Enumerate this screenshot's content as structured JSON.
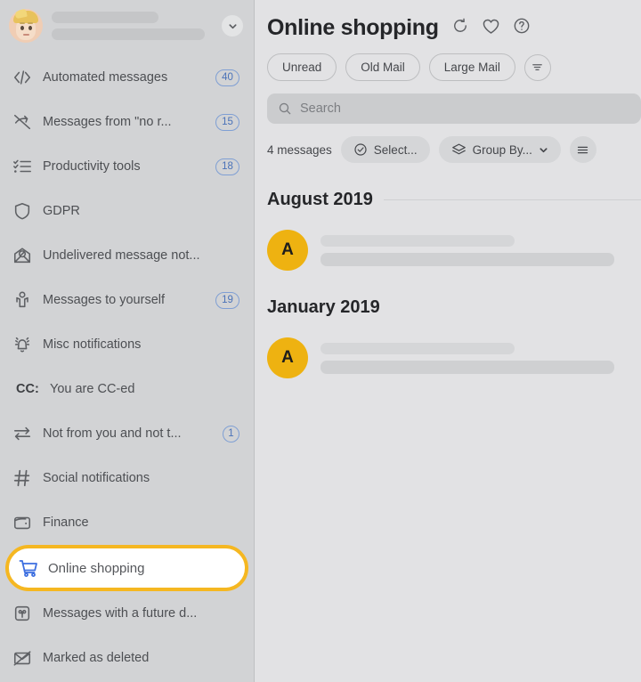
{
  "sidebar": {
    "account": {
      "avatar_name": "user-memoji-avatar",
      "expand_icon": "chevron-down-icon"
    },
    "items": [
      {
        "label": "Automated messages",
        "badge": "40",
        "icon": "code-brackets-icon",
        "selected": false
      },
      {
        "label": "Messages from \"no r...",
        "badge": "15",
        "icon": "no-reply-slash-icon",
        "selected": false
      },
      {
        "label": "Productivity tools",
        "badge": "18",
        "icon": "checklist-icon",
        "selected": false
      },
      {
        "label": "GDPR",
        "badge": "",
        "icon": "shield-icon",
        "selected": false
      },
      {
        "label": "Undelivered message not...",
        "badge": "",
        "icon": "undelivered-envelope-icon",
        "selected": false
      },
      {
        "label": "Messages to yourself",
        "badge": "19",
        "icon": "person-icon",
        "selected": false
      },
      {
        "label": "Misc notifications",
        "badge": "",
        "icon": "bell-ringing-icon",
        "selected": false
      },
      {
        "label": "You are CC-ed",
        "badge": "",
        "icon": "cc-text-icon",
        "prefix": "CC:",
        "selected": false
      },
      {
        "label": "Not from you and not t...",
        "badge": "1",
        "icon": "two-way-arrows-icon",
        "selected": false
      },
      {
        "label": "Social notifications",
        "badge": "",
        "icon": "hash-icon",
        "selected": false
      },
      {
        "label": "Finance",
        "badge": "",
        "icon": "wallet-icon",
        "selected": false
      },
      {
        "label": "Online shopping",
        "badge": "",
        "icon": "shopping-cart-icon",
        "selected": true
      },
      {
        "label": "Messages with a future d...",
        "badge": "",
        "icon": "future-date-icon",
        "selected": false
      },
      {
        "label": "Marked as deleted",
        "badge": "",
        "icon": "deleted-envelope-icon",
        "selected": false
      }
    ]
  },
  "main": {
    "title": "Online shopping",
    "header_icons": [
      {
        "name": "refresh-icon"
      },
      {
        "name": "heart-icon"
      },
      {
        "name": "help-icon"
      }
    ],
    "filter_pills": [
      {
        "label": "Unread"
      },
      {
        "label": "Old Mail"
      },
      {
        "label": "Large Mail"
      }
    ],
    "filter_icon_button": "filter-sort-icon",
    "search": {
      "placeholder": "Search",
      "icon": "search-icon"
    },
    "toolbar": {
      "count_label": "4 messages",
      "select_label": "Select...",
      "select_icon": "check-circle-icon",
      "group_by_label": "Group By...",
      "group_by_icon": "layers-icon",
      "group_by_chevron": "chevron-down-icon",
      "more_icon": "more-options-icon"
    },
    "groups": [
      {
        "title": "August 2019",
        "messages": [
          {
            "avatar_initial": "A"
          }
        ]
      },
      {
        "title": "January 2019",
        "messages": [
          {
            "avatar_initial": "A"
          }
        ]
      }
    ]
  },
  "colors": {
    "highlight": "#f5b721",
    "accent_blue": "#3d6fe0",
    "badge_blue": "#4a72b8",
    "avatar_amber": "#eeb211",
    "sidebar_bg": "#d2d3d5",
    "main_bg": "#e2e2e4"
  }
}
